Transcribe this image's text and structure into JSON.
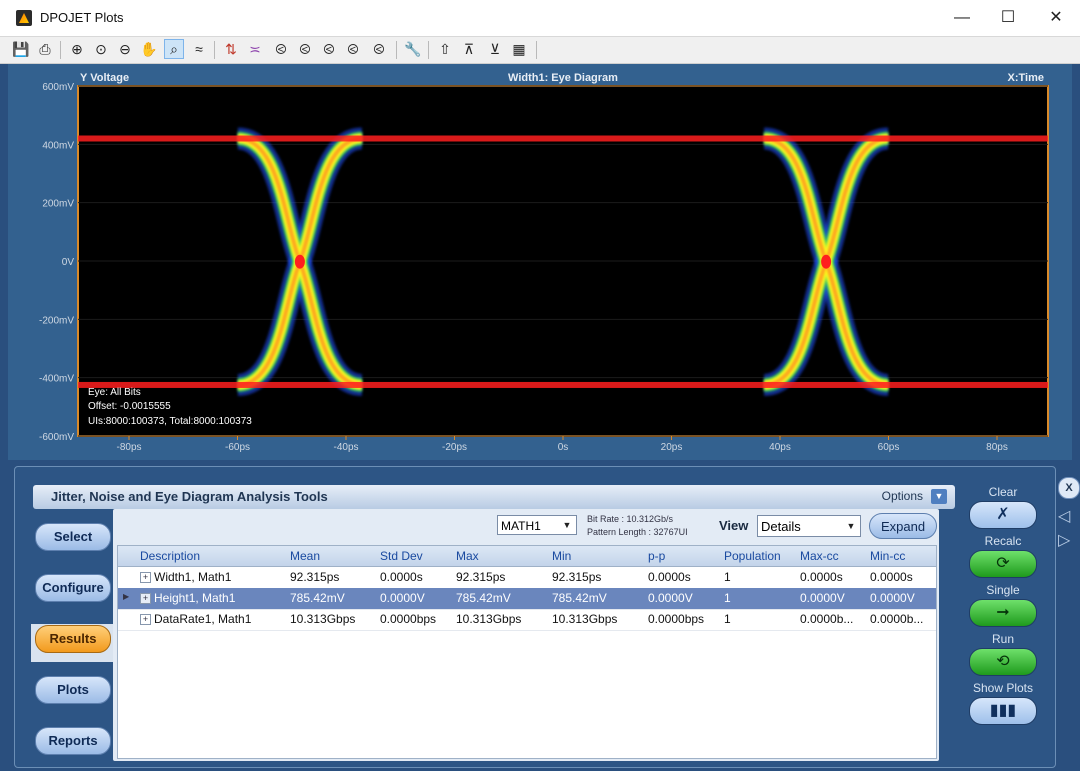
{
  "window": {
    "title": "DPOJET Plots",
    "minimize": "—",
    "maximize": "☐",
    "close": "✕"
  },
  "toolbar": {
    "icons": [
      "save-icon",
      "print-icon",
      "zoom-in-icon",
      "zoom-area-icon",
      "zoom-out-icon",
      "pan-hand-icon",
      "zoom-100-icon",
      "track-icon",
      "cursor-icon",
      "measure-icon",
      "waveform-1-icon",
      "waveform-2-icon",
      "waveform-3-icon",
      "waveform-4-icon",
      "waveform-5-icon",
      "wrench-icon",
      "export-1-icon",
      "export-2-icon",
      "export-3-icon",
      "export-4-icon"
    ]
  },
  "plot": {
    "y_label": "Voltage",
    "x_label": "Time",
    "title": "Width1: Eye Diagram",
    "y_ticks": [
      "600mV",
      "400mV",
      "200mV",
      "0V",
      "-200mV",
      "-400mV",
      "-600mV"
    ],
    "x_ticks": [
      "-80ps",
      "-60ps",
      "-40ps",
      "-20ps",
      "0s",
      "20ps",
      "40ps",
      "60ps",
      "80ps"
    ],
    "annotations": {
      "line1": "Eye: All Bits",
      "line2": "Offset: -0.0015555",
      "line3": "UIs:8000:100373, Total:8000:100373"
    },
    "colors": {
      "background": "#000000",
      "frame": "#d98a2b",
      "low_density": "#2050ff",
      "mid_density": "#ffff20",
      "high_density": "#ff1e1e"
    }
  },
  "panel": {
    "title": "Jitter, Noise and Eye Diagram Analysis Tools",
    "options_label": "Options",
    "nav": {
      "select": "Select",
      "configure": "Configure",
      "results": "Results",
      "plots": "Plots",
      "reports": "Reports"
    },
    "source_value": "MATH1",
    "bit_rate": "Bit Rate : 10.312Gb/s",
    "pattern_length": "Pattern Length : 32767UI",
    "view_label": "View",
    "view_value": "Details",
    "expand_label": "Expand"
  },
  "table": {
    "columns": [
      "Description",
      "Mean",
      "Std Dev",
      "Max",
      "Min",
      "p-p",
      "Population",
      "Max-cc",
      "Min-cc"
    ],
    "rows": [
      {
        "description": "Width1, Math1",
        "mean": "92.315ps",
        "std_dev": "0.0000s",
        "max": "92.315ps",
        "min": "92.315ps",
        "pp": "0.0000s",
        "population": "1",
        "max_cc": "0.0000s",
        "min_cc": "0.0000s"
      },
      {
        "description": "Height1, Math1",
        "mean": "785.42mV",
        "std_dev": "0.0000V",
        "max": "785.42mV",
        "min": "785.42mV",
        "pp": "0.0000V",
        "population": "1",
        "max_cc": "0.0000V",
        "min_cc": "0.0000V"
      },
      {
        "description": "DataRate1, Math1",
        "mean": "10.313Gbps",
        "std_dev": "0.0000bps",
        "max": "10.313Gbps",
        "min": "10.313Gbps",
        "pp": "0.0000bps",
        "population": "1",
        "max_cc": "0.0000b...",
        "min_cc": "0.0000b..."
      }
    ]
  },
  "controls": {
    "clear": "Clear",
    "recalc": "Recalc",
    "single": "Single",
    "run": "Run",
    "show_plots": "Show Plots",
    "close_panel": "X"
  }
}
